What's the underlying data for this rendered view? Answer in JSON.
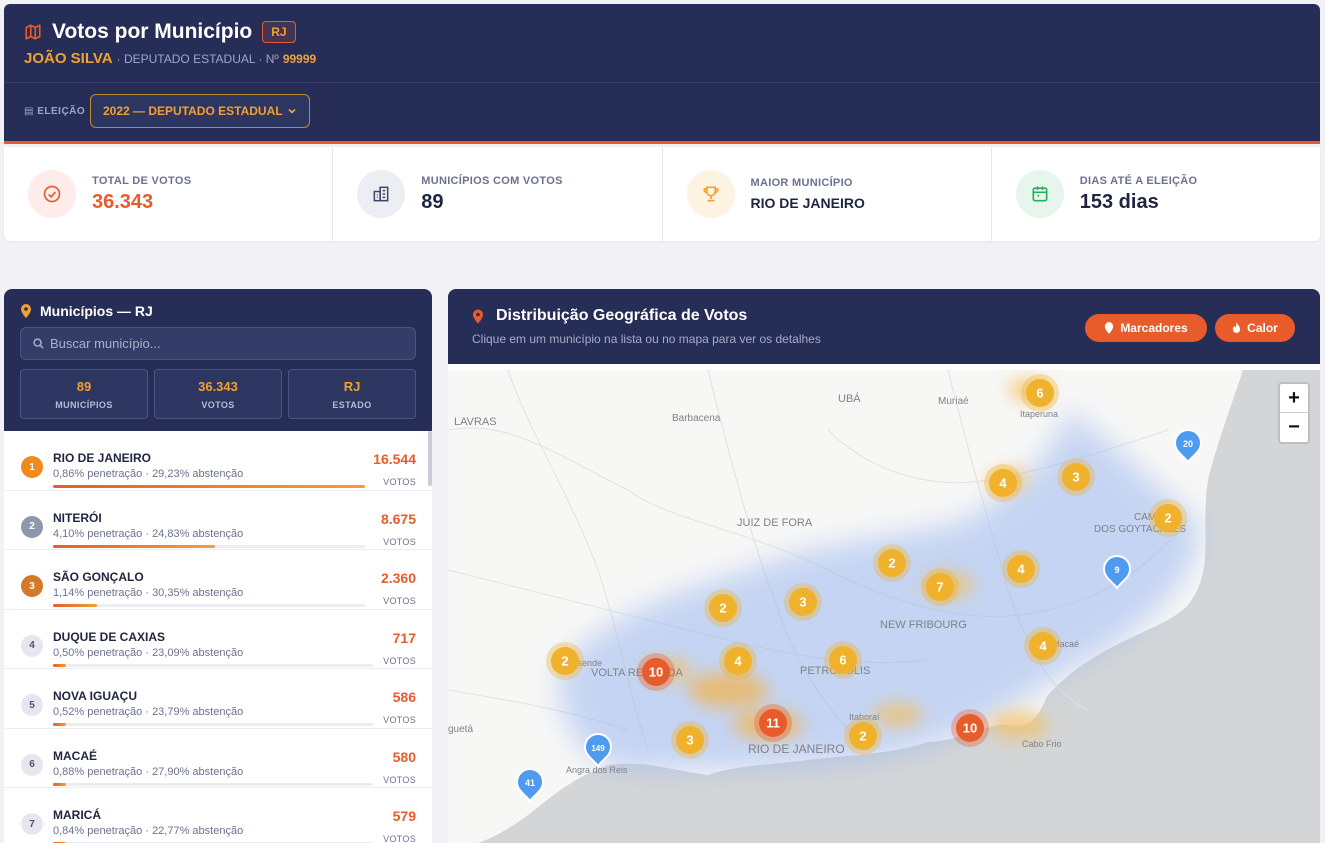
{
  "header": {
    "title": "Votos por Município",
    "state_badge": "RJ",
    "candidate": "JOÃO SILVA",
    "role": "· DEPUTADO ESTADUAL · Nº",
    "number": "99999",
    "election_label": "ELEIÇÃO",
    "election_value": "2022 — DEPUTADO ESTADUAL"
  },
  "stats": [
    {
      "label": "TOTAL DE VOTOS",
      "value": "36.343"
    },
    {
      "label": "MUNICÍPIOS COM VOTOS",
      "value": "89"
    },
    {
      "label": "MAIOR MUNICÍPIO",
      "value": "RIO DE JANEIRO"
    },
    {
      "label": "DIAS ATÉ A ELEIÇÃO",
      "value": "153 dias"
    }
  ],
  "colors": {
    "navy": "#262e57",
    "accent": "#e85c2c",
    "gold": "#f2a032",
    "blue": "#4f9bf0"
  },
  "left": {
    "title": "Municípios — RJ",
    "search_placeholder": "Buscar município...",
    "minis": [
      {
        "value": "89",
        "label": "MUNICÍPIOS"
      },
      {
        "value": "36.343",
        "label": "VOTOS"
      },
      {
        "value": "RJ",
        "label": "ESTADO"
      }
    ],
    "votes_label": "VOTOS",
    "items": [
      {
        "rank": "1",
        "name": "RIO DE JANEIRO",
        "detail": "0,86% penetração · 29,23% abstenção",
        "votes": "16.544",
        "share": 1.0
      },
      {
        "rank": "2",
        "name": "NITERÓI",
        "detail": "4,10% penetração · 24,83% abstenção",
        "votes": "8.675",
        "share": 0.52
      },
      {
        "rank": "3",
        "name": "SÃO GONÇALO",
        "detail": "1,14% penetração · 30,35% abstenção",
        "votes": "2.360",
        "share": 0.14
      },
      {
        "rank": "4",
        "name": "DUQUE DE CAXIAS",
        "detail": "0,50% penetração · 23,09% abstenção",
        "votes": "717",
        "share": 0.04
      },
      {
        "rank": "5",
        "name": "NOVA IGUAÇU",
        "detail": "0,52% penetração · 23,79% abstenção",
        "votes": "586",
        "share": 0.04
      },
      {
        "rank": "6",
        "name": "MACAÉ",
        "detail": "0,88% penetração · 27,90% abstenção",
        "votes": "580",
        "share": 0.04
      },
      {
        "rank": "7",
        "name": "MARICÁ",
        "detail": "0,84% penetração · 22,77% abstenção",
        "votes": "579",
        "share": 0.04
      }
    ]
  },
  "map": {
    "title": "Distribuição Geográfica de Votos",
    "subtitle": "Clique em um município na lista ou no mapa para ver os detalhes",
    "btn_markers": "Marcadores",
    "btn_heat": "Calor",
    "zoom_in": "+",
    "zoom_out": "−",
    "labels": [
      "LAVRAS",
      "Barbacena",
      "UBÁ",
      "Muriaé",
      "Itaperuna",
      "JUIZ DE FORA",
      "CAMPOS DOS GOYTACAZES",
      "NEW FRIBOURG",
      "VOLTA REDONDA",
      "PETRÓPOLIS",
      "RIO DE JANEIRO",
      "Itaboraí",
      "Cabo Frio",
      "Macaé",
      "Angra dos Reis",
      "guetá",
      "Resende"
    ],
    "clusters": [
      "6",
      "20",
      "4",
      "3",
      "2",
      "2",
      "4",
      "9",
      "7",
      "2",
      "3",
      "4",
      "2",
      "10",
      "4",
      "6",
      "11",
      "3",
      "2",
      "10",
      "149",
      "41"
    ]
  }
}
